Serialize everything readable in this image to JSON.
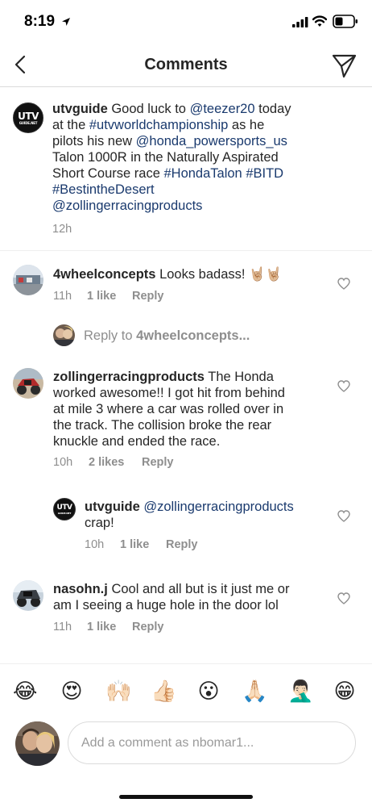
{
  "status_bar": {
    "time": "8:19"
  },
  "header": {
    "title": "Comments"
  },
  "caption": {
    "username": "utvguide",
    "logo_text": "UTV",
    "logo_sub": "GUIDE.NET",
    "lines": [
      [
        {
          "t": "Good luck to "
        },
        {
          "t": "@teezer20",
          "link": true
        },
        {
          "t": " today"
        }
      ],
      [
        {
          "t": "at the "
        },
        {
          "t": "#utvworldchampionship",
          "link": true
        },
        {
          "t": " as he"
        }
      ],
      [
        {
          "t": "pilots his new "
        },
        {
          "t": "@honda_powersports_us",
          "link": true
        }
      ],
      [
        {
          "t": "Talon 1000R in the Naturally Aspirated"
        }
      ],
      [
        {
          "t": "Short Course race "
        },
        {
          "t": "#HondaTalon",
          "link": true
        },
        {
          "t": " "
        },
        {
          "t": "#BITD",
          "link": true
        }
      ],
      [
        {
          "t": "#BestintheDesert",
          "link": true
        }
      ],
      [
        {
          "t": "@zollingerracingproducts",
          "link": true
        }
      ]
    ],
    "time": "12h"
  },
  "comments": [
    {
      "username": "4wheelconcepts",
      "first_line": "Looks badass! 🤘🏼🤘🏼",
      "time": "11h",
      "likes": "1 like",
      "reply": "Reply"
    },
    {
      "username": "zollingerracingproducts",
      "first_line": "The Honda",
      "more_lines": [
        "worked awesome!! I got hit from behind",
        "at mile 3 where a car was rolled over in",
        "the track. The collision broke the rear",
        "knuckle and ended the race."
      ],
      "time": "10h",
      "likes": "2 likes",
      "reply": "Reply"
    },
    {
      "username": "nasohn.j",
      "first_line": "Cool and all but is it just me or",
      "more_lines": [
        "am I seeing a huge hole in the door lol"
      ],
      "time": "11h",
      "likes": "1 like",
      "reply": "Reply"
    }
  ],
  "reply_prompt": {
    "prefix": "Reply to ",
    "target": "4wheelconcepts..."
  },
  "reply": {
    "username": "utvguide",
    "mention": "@zollingerracingproducts",
    "text": "crap!",
    "time": "10h",
    "likes": "1 like",
    "reply": "Reply"
  },
  "emojis": [
    "😂",
    "😍",
    "🙌🏻",
    "👍🏻",
    "😮",
    "🙏🏻",
    "🤦🏻‍♂️",
    "😁"
  ],
  "input": {
    "placeholder": "Add a comment as nbomar1..."
  }
}
